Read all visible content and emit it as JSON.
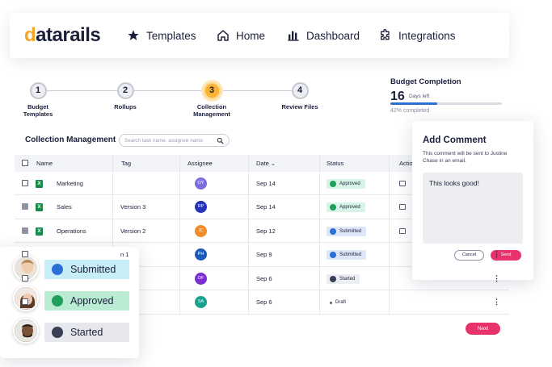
{
  "brand": {
    "logo_text": "datarails",
    "logo_d_color": "#f5a623"
  },
  "nav": {
    "items": [
      {
        "label": "Templates",
        "icon": "star-icon"
      },
      {
        "label": "Home",
        "icon": "home-icon"
      },
      {
        "label": "Dashboard",
        "icon": "bar-chart-icon"
      },
      {
        "label": "Integrations",
        "icon": "puzzle-icon"
      }
    ]
  },
  "stepper": {
    "steps": [
      {
        "num": "1",
        "label": "Budget\nTemplates"
      },
      {
        "num": "2",
        "label": "Rollups"
      },
      {
        "num": "3",
        "label": "Collection\nManagement",
        "active": true
      },
      {
        "num": "4",
        "label": "Review Files"
      }
    ]
  },
  "budget": {
    "title": "Budget Completion",
    "days": "16",
    "days_label": "Days left",
    "completion": 0.42,
    "completion_label": "42% completed"
  },
  "collection": {
    "title": "Collection Management",
    "search_placeholder": "Search task name, assignee name"
  },
  "table": {
    "headers": {
      "name": "Name",
      "tag": "Tag",
      "assignee": "Assignee",
      "date": "Date",
      "status": "Status",
      "actions": "Actio"
    },
    "rows": [
      {
        "name": "Marketing",
        "tag": "",
        "assignee": "OY",
        "assignee_color": "#7b6fe0",
        "date": "Sep 14",
        "status": "Approved",
        "status_kind": "approved",
        "checked": false
      },
      {
        "name": "Sales",
        "tag": "Version 3",
        "assignee": "RP",
        "assignee_color": "#2433b8",
        "date": "Sep 14",
        "status": "Approved",
        "status_kind": "approved",
        "checked": true
      },
      {
        "name": "Operations",
        "tag": "Version 2",
        "assignee": "JC",
        "assignee_color": "#f08c2b",
        "date": "Sep 12",
        "status": "Submitted",
        "status_kind": "submitted",
        "checked": true
      },
      {
        "name": "",
        "tag": "n 1",
        "assignee": "PH",
        "assignee_color": "#1e5bb8",
        "date": "Sep 9",
        "status": "Submitted",
        "status_kind": "submitted",
        "checked": false
      },
      {
        "name": "",
        "tag": "",
        "assignee": "OF",
        "assignee_color": "#7a2fd0",
        "date": "Sep 6",
        "status": "Started",
        "status_kind": "started",
        "checked": false
      },
      {
        "name": "",
        "tag": "",
        "assignee": "SA",
        "assignee_color": "#1aa08e",
        "date": "Sep 6",
        "status": "Draft",
        "status_kind": "draft",
        "checked": false
      }
    ]
  },
  "next_label": "Next",
  "comment": {
    "title": "Add Comment",
    "subtitle": "This comment will be sent to Justine Chase in an email.",
    "text": "This looks good!",
    "cancel": "Cancel",
    "send": "Send"
  },
  "legend": {
    "items": [
      {
        "label": "Submitted",
        "kind": "submitted"
      },
      {
        "label": "Approved",
        "kind": "approved"
      },
      {
        "label": "Started",
        "kind": "started"
      }
    ]
  }
}
